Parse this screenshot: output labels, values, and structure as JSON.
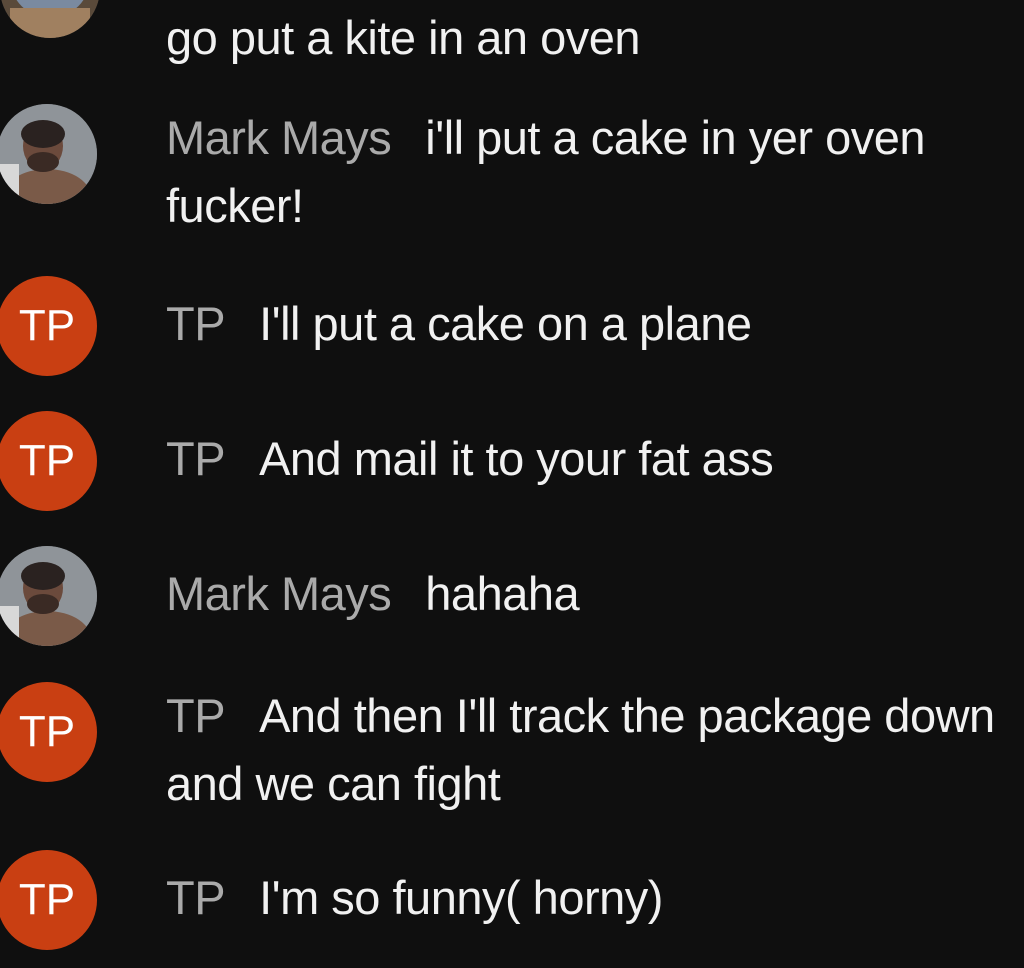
{
  "messages": [
    {
      "author": "",
      "text": "go put a kite in an oven",
      "avatar": "photo-partial"
    },
    {
      "author": "Mark Mays",
      "text": "i'll put a cake in yer oven fucker!",
      "avatar": "photo"
    },
    {
      "author": "TP",
      "text": "I'll put a cake on a plane",
      "avatar": "initials",
      "initials": "TP"
    },
    {
      "author": "TP",
      "text": "And mail it to your fat ass",
      "avatar": "initials",
      "initials": "TP"
    },
    {
      "author": "Mark Mays",
      "text": "hahaha",
      "avatar": "photo"
    },
    {
      "author": "TP",
      "text": "And then I'll track the package down and we can fight",
      "avatar": "initials",
      "initials": "TP"
    },
    {
      "author": "TP",
      "text": "I'm so funny( horny)",
      "avatar": "initials",
      "initials": "TP"
    }
  ],
  "colors": {
    "background": "#0f0f0f",
    "author_name": "#aaaaaa",
    "message_text": "#f1f1f1",
    "initials_avatar": "#c93f12"
  }
}
